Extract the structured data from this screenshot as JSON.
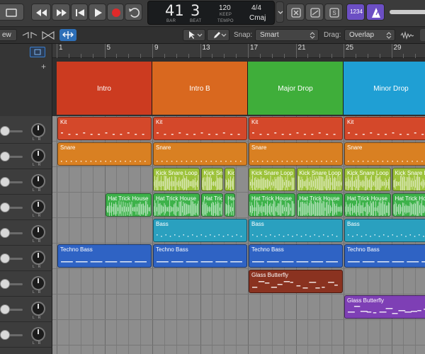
{
  "transport": {
    "rewind_icon": "rewind-icon",
    "forward_icon": "fast-forward-icon",
    "tostart_icon": "go-to-start-icon",
    "play_icon": "play-icon",
    "record_icon": "record-icon",
    "cycle_icon": "cycle-icon"
  },
  "lcd": {
    "bar": "41",
    "beat": "3",
    "bar_label": "BAR",
    "beat_label": "BEAT",
    "tempo": "120",
    "keep_label": "KEEP",
    "tempo_label": "TEMPO",
    "signature": "4/4",
    "key": "Cmaj"
  },
  "controlbar_right": {
    "count_in": "1234",
    "colors": {
      "purple": "#6c4fc4"
    }
  },
  "toolbar": {
    "view_menu": "ew",
    "snap_label": "Snap:",
    "snap_value": "Smart",
    "drag_label": "Drag:",
    "drag_value": "Overlap"
  },
  "ruler": {
    "bars": [
      "1",
      "5",
      "9",
      "13",
      "17",
      "21",
      "25",
      "29"
    ]
  },
  "arrangement": [
    {
      "name": "Intro",
      "color": "#cc3b20"
    },
    {
      "name": "Intro B",
      "color": "#d9681f"
    },
    {
      "name": "Major Drop",
      "color": "#3fae3a"
    },
    {
      "name": "Minor Drop",
      "color": "#1f9fd4"
    }
  ],
  "tracks": [
    {
      "regions": [
        {
          "name": "Kit",
          "color": "#d4482a",
          "start": 1,
          "end": 9,
          "pattern": "dashes"
        },
        {
          "name": "Kit",
          "color": "#d4482a",
          "start": 9,
          "end": 17,
          "pattern": "dashes"
        },
        {
          "name": "Kit",
          "color": "#d4482a",
          "start": 17,
          "end": 25,
          "pattern": "dashes"
        },
        {
          "name": "Kit",
          "color": "#d4482a",
          "start": 25,
          "end": 33,
          "pattern": "dashes"
        }
      ]
    },
    {
      "regions": [
        {
          "name": "Snare",
          "color": "#d98022",
          "start": 1,
          "end": 9,
          "pattern": "dots"
        },
        {
          "name": "Snare",
          "color": "#d98022",
          "start": 9,
          "end": 17,
          "pattern": "dots"
        },
        {
          "name": "Snare",
          "color": "#d98022",
          "start": 17,
          "end": 25,
          "pattern": "dots"
        },
        {
          "name": "Snare",
          "color": "#d98022",
          "start": 25,
          "end": 33,
          "pattern": "dots"
        }
      ]
    },
    {
      "regions": [
        {
          "name": "Kick Snare Loop",
          "color": "#9cc23a",
          "start": 9,
          "end": 13,
          "pattern": "wave"
        },
        {
          "name": "Kick Sn",
          "color": "#9cc23a",
          "start": 13,
          "end": 15,
          "pattern": "wave"
        },
        {
          "name": "Kic",
          "color": "#9cc23a",
          "start": 15,
          "end": 16,
          "pattern": "wave"
        },
        {
          "name": "Kick Snare Loop",
          "color": "#9cc23a",
          "start": 17,
          "end": 21,
          "pattern": "wave"
        },
        {
          "name": "Kick Snare Loop",
          "color": "#9cc23a",
          "start": 21,
          "end": 25,
          "pattern": "wave"
        },
        {
          "name": "Kick Snare Loop",
          "color": "#9cc23a",
          "start": 25,
          "end": 29,
          "pattern": "wave"
        },
        {
          "name": "Kick Snare Loop",
          "color": "#9cc23a",
          "start": 29,
          "end": 33,
          "pattern": "wave"
        }
      ]
    },
    {
      "regions": [
        {
          "name": "Hat Trick House",
          "color": "#3db24a",
          "start": 5,
          "end": 9,
          "pattern": "wave"
        },
        {
          "name": "Hat Trick House",
          "color": "#3db24a",
          "start": 9,
          "end": 13,
          "pattern": "wave"
        },
        {
          "name": "Hat Trick",
          "color": "#3db24a",
          "start": 13,
          "end": 15,
          "pattern": "wave"
        },
        {
          "name": "Ha",
          "color": "#3db24a",
          "start": 15,
          "end": 16,
          "pattern": "wave"
        },
        {
          "name": "Hat Trick House",
          "color": "#3db24a",
          "start": 17,
          "end": 21,
          "pattern": "wave"
        },
        {
          "name": "Hat Trick House",
          "color": "#3db24a",
          "start": 21,
          "end": 25,
          "pattern": "wave"
        },
        {
          "name": "Hat Trick House",
          "color": "#3db24a",
          "start": 25,
          "end": 29,
          "pattern": "wave"
        },
        {
          "name": "Hat Trick House",
          "color": "#3db24a",
          "start": 29,
          "end": 33,
          "pattern": "wave"
        }
      ]
    },
    {
      "regions": [
        {
          "name": "Bass",
          "color": "#2aa0bf",
          "start": 9,
          "end": 17,
          "pattern": "notes"
        },
        {
          "name": "Bass",
          "color": "#2aa0bf",
          "start": 17,
          "end": 25,
          "pattern": "notes"
        },
        {
          "name": "Bass",
          "color": "#2aa0bf",
          "start": 25,
          "end": 33,
          "pattern": "notes"
        }
      ]
    },
    {
      "regions": [
        {
          "name": "Techno Bass",
          "color": "#2f63c4",
          "start": 1,
          "end": 9,
          "pattern": "longnotes"
        },
        {
          "name": "Techno Bass",
          "color": "#2f63c4",
          "start": 9,
          "end": 17,
          "pattern": "longnotes"
        },
        {
          "name": "Techno Bass",
          "color": "#2f63c4",
          "start": 17,
          "end": 25,
          "pattern": "longnotes"
        },
        {
          "name": "Techno Bass",
          "color": "#2f63c4",
          "start": 25,
          "end": 33,
          "pattern": "longnotes"
        }
      ]
    },
    {
      "regions": [
        {
          "name": "Glass Butterfly",
          "color": "#8a3220",
          "start": 17,
          "end": 25,
          "pattern": "melody"
        }
      ]
    },
    {
      "regions": [
        {
          "name": "Glass Butterfly",
          "color": "#7e3fb5",
          "start": 25,
          "end": 33,
          "pattern": "melody"
        }
      ]
    },
    {
      "regions": []
    }
  ]
}
